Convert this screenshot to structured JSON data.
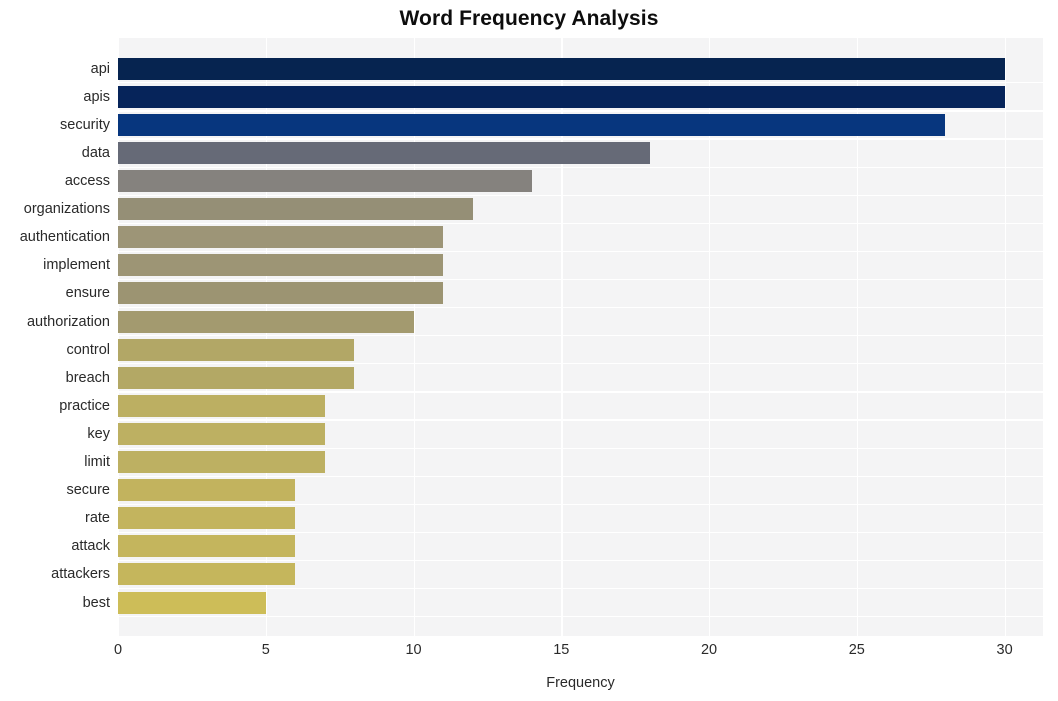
{
  "chart_data": {
    "type": "bar",
    "orientation": "horizontal",
    "title": "Word Frequency Analysis",
    "xlabel": "Frequency",
    "ylabel": "",
    "xlim": [
      0,
      31.3
    ],
    "ylim": null,
    "grid": true,
    "legend": null,
    "xticks": [
      0,
      5,
      10,
      15,
      20,
      25,
      30
    ],
    "xtick_labels": [
      "0",
      "5",
      "10",
      "15",
      "20",
      "25",
      "30"
    ],
    "categories": [
      "api",
      "apis",
      "security",
      "data",
      "access",
      "organizations",
      "authentication",
      "implement",
      "ensure",
      "authorization",
      "control",
      "breach",
      "practice",
      "key",
      "limit",
      "secure",
      "rate",
      "attack",
      "attackers",
      "best"
    ],
    "values": [
      30,
      30,
      28,
      18,
      14,
      12,
      11,
      11,
      11,
      10,
      8,
      8,
      7,
      7,
      7,
      6,
      6,
      6,
      6,
      5
    ],
    "bar_colors": [
      "#062450",
      "#06245a",
      "#07367e",
      "#666a77",
      "#85827e",
      "#958f76",
      "#9d9577",
      "#9d9575",
      "#9c9472",
      "#a39a6f",
      "#b2a766",
      "#b3a865",
      "#bcaf62",
      "#bdb062",
      "#bdb062",
      "#c2b35e",
      "#c3b45e",
      "#c4b55d",
      "#c5b65c",
      "#cdbd58"
    ],
    "plot_background": "#f4f4f5",
    "grid_color": "#ffffff",
    "figure_background": "#ffffff",
    "text_color": "#2a2a2a"
  }
}
